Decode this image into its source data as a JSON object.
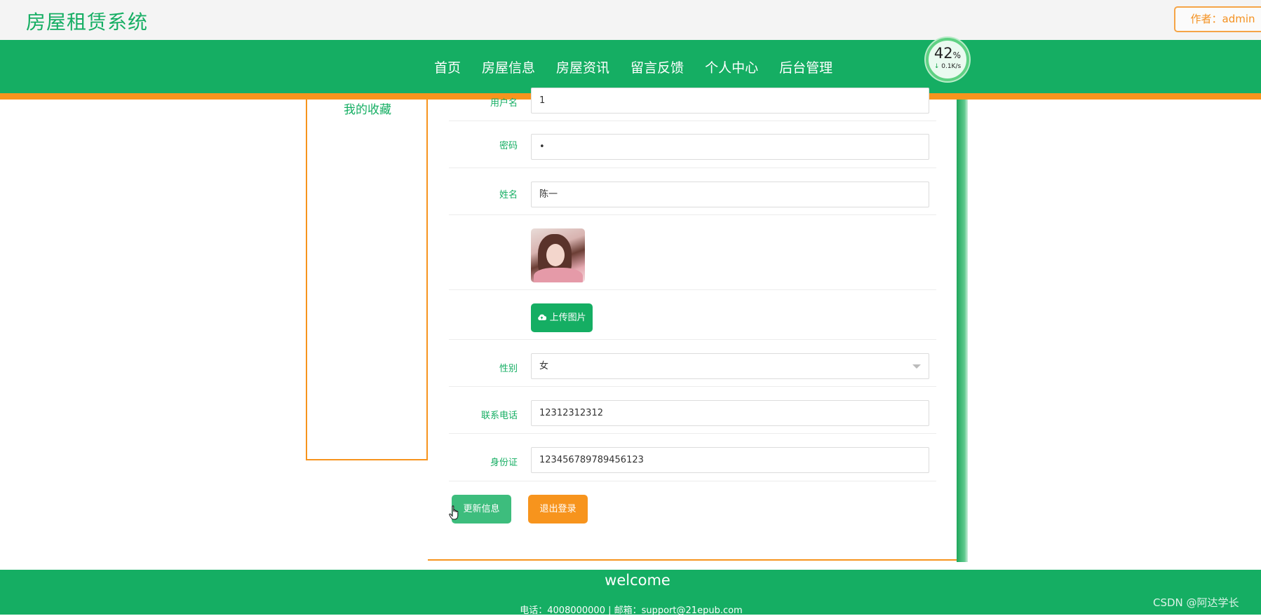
{
  "header": {
    "site_title": "房屋租赁系统",
    "author_label": "作者：admin"
  },
  "nav": {
    "items": [
      "首页",
      "房屋信息",
      "房屋资讯",
      "留言反馈",
      "个人中心",
      "后台管理"
    ]
  },
  "speed_widget": {
    "percent": "42",
    "percent_unit": "%",
    "rate": "0.1K/s"
  },
  "sidebar": {
    "favorites_label": "我的收藏"
  },
  "form": {
    "username_label": "用户名",
    "username_value": "1",
    "password_label": "密码",
    "password_value": "•",
    "name_label": "姓名",
    "name_value": "陈一",
    "upload_label": "上传图片",
    "gender_label": "性别",
    "gender_value": "女",
    "phone_label": "联系电话",
    "phone_value": "12312312312",
    "id_label": "身份证",
    "id_value": "123456789789456123"
  },
  "actions": {
    "update_label": "更新信息",
    "logout_label": "退出登录"
  },
  "footer": {
    "title": "welcome",
    "contact": "电话：4008000000 | 邮箱：support@21epub.com"
  },
  "watermark": "CSDN @阿达学长",
  "colors": {
    "primary_green": "#15ae63",
    "accent_orange": "#f7941d"
  }
}
